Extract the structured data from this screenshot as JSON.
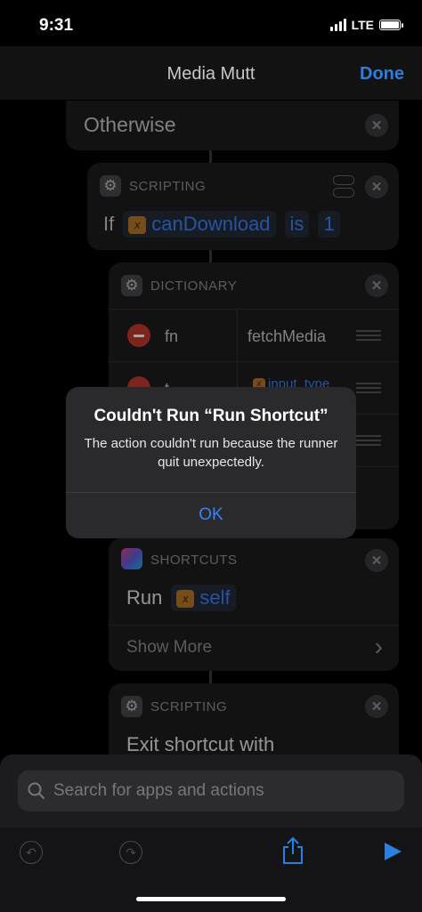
{
  "status": {
    "time": "9:31",
    "network": "LTE"
  },
  "nav": {
    "title": "Media Mutt",
    "done": "Done"
  },
  "otherwise": {
    "label": "Otherwise"
  },
  "if_block": {
    "category": "SCRIPTING",
    "keyword": "If",
    "variable": "canDownload",
    "operator": "is",
    "value": "1"
  },
  "dictionary": {
    "category": "DICTIONARY",
    "rows": [
      {
        "key": "fn",
        "value": "fetchMedia"
      },
      {
        "key": "t",
        "value": "input_type"
      }
    ]
  },
  "shortcuts": {
    "category": "SHORTCUTS",
    "action": "Run",
    "variable": "self",
    "show_more": "Show More"
  },
  "exit_block": {
    "category": "SCRIPTING",
    "text": "Exit shortcut with"
  },
  "alert": {
    "title": "Couldn't Run “Run Shortcut”",
    "message": "The action couldn't run because the runner quit unexpectedly.",
    "ok": "OK"
  },
  "search": {
    "placeholder": "Search for apps and actions"
  },
  "icons": {
    "variable_badge": "x",
    "gear": "⚙",
    "close": "✕",
    "chevron": "›"
  }
}
